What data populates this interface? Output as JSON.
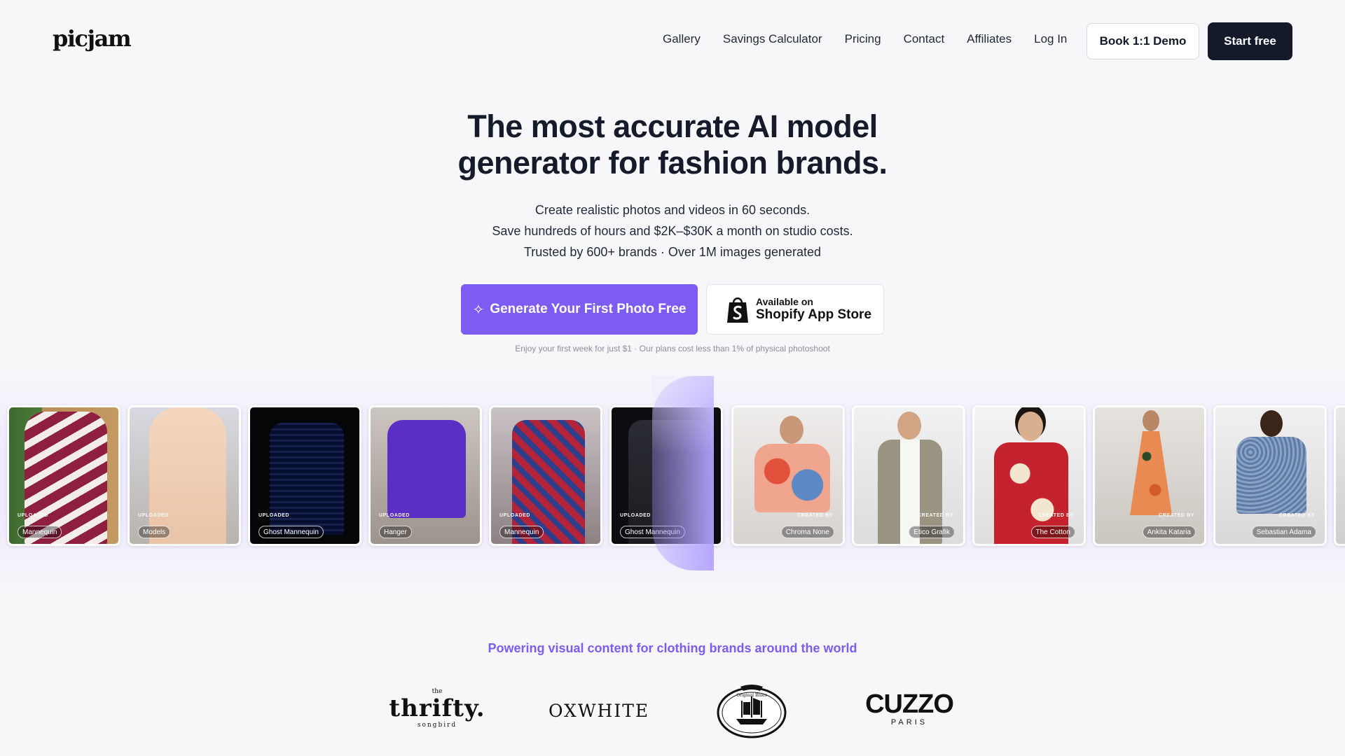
{
  "header": {
    "logo": "picjam",
    "nav": [
      "Gallery",
      "Savings Calculator",
      "Pricing",
      "Contact",
      "Affiliates",
      "Log In"
    ],
    "demo_button": "Book 1:1 Demo",
    "start_button": "Start free"
  },
  "hero": {
    "title_line1": "The most accurate AI model",
    "title_line2": "generator for fashion brands.",
    "sub_line1": "Create realistic photos and videos in 60 seconds.",
    "sub_line2": "Save hundreds of hours and $2K–$30K a month on studio costs.",
    "sub_line3": "Trusted by 600+ brands  · Over 1M images generated",
    "cta_primary": "Generate Your First Photo Free",
    "shopify_small": "Available on",
    "shopify_big": "Shopify App Store",
    "fineprint": "Enjoy your first week for just $1 · Our plans cost less than 1% of physical photoshoot"
  },
  "gallery": {
    "uploaded_label": "UPLOADED",
    "created_label": "CREATED BY",
    "cards": [
      {
        "type": "uploaded",
        "tag": "Mannequin"
      },
      {
        "type": "uploaded",
        "tag": "Models"
      },
      {
        "type": "uploaded",
        "tag": "Ghost Mannequin"
      },
      {
        "type": "uploaded",
        "tag": "Hanger"
      },
      {
        "type": "uploaded",
        "tag": "Mannequin"
      },
      {
        "type": "uploaded",
        "tag": "Ghost Mannequin"
      },
      {
        "type": "created",
        "tag": "Chroma None"
      },
      {
        "type": "created",
        "tag": "Etico Grafik"
      },
      {
        "type": "created",
        "tag": "The Cotton"
      },
      {
        "type": "created",
        "tag": "Ankita Kataria"
      },
      {
        "type": "created",
        "tag": "Sebastian Adama"
      }
    ]
  },
  "trust": {
    "heading": "Powering visual content for clothing brands around the world",
    "thrifty_top": "the",
    "thrifty_main": "thrifty.",
    "thrifty_bottom": "songbird",
    "oxwhite": "OXWHITE",
    "seal_text": "Original Blues",
    "cuzzo_main": "CUZZO",
    "cuzzo_sub": "PARIS"
  },
  "colors": {
    "accent": "#7c5cf2",
    "dark_button": "#151a2b",
    "slider": "#b3a3ff"
  }
}
